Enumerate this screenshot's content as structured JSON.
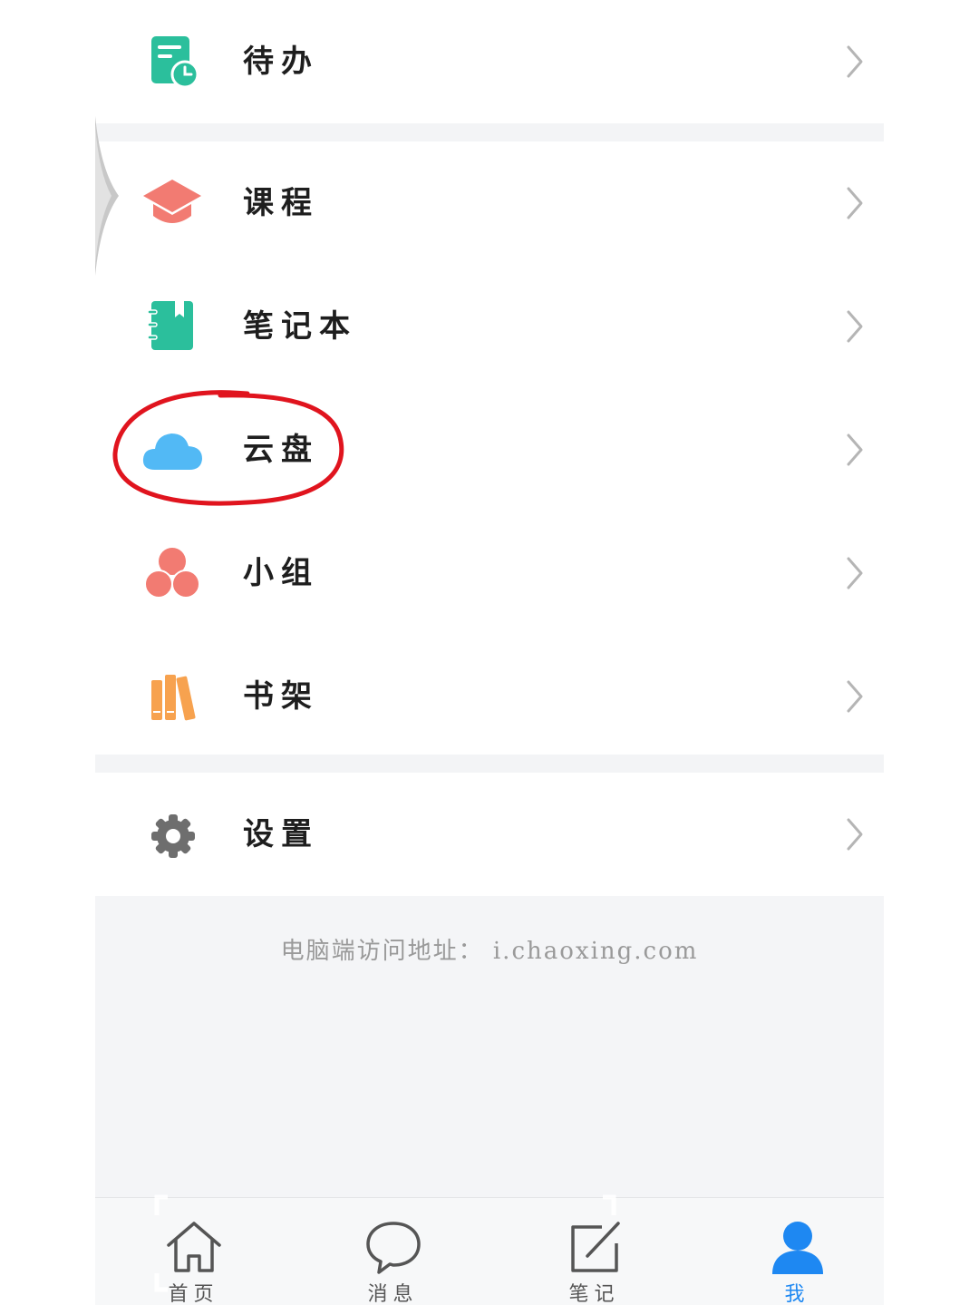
{
  "menu": {
    "items": [
      {
        "label": "待办",
        "icon": "todo-document-clock-icon",
        "color": "#2bbf9c"
      },
      {
        "label": "课程",
        "icon": "graduation-cap-icon",
        "color": "#f27b72"
      },
      {
        "label": "笔记本",
        "icon": "notebook-icon",
        "color": "#2bbf9c"
      },
      {
        "label": "云盘",
        "icon": "cloud-icon",
        "color": "#52b9f5"
      },
      {
        "label": "小组",
        "icon": "group-circles-icon",
        "color": "#f27b72"
      },
      {
        "label": "书架",
        "icon": "bookshelf-icon",
        "color": "#f7a24f"
      },
      {
        "label": "设置",
        "icon": "gear-icon",
        "color": "#6e6e6e"
      }
    ],
    "chevron_icon": "chevron-right-icon"
  },
  "footer": {
    "pc_address": "电脑端访问地址： i.chaoxing.com"
  },
  "tabbar": {
    "tabs": [
      {
        "label": "首页",
        "icon": "home-icon",
        "active": false
      },
      {
        "label": "消息",
        "icon": "message-bubble-icon",
        "active": false
      },
      {
        "label": "笔记",
        "icon": "note-edit-icon",
        "active": false
      },
      {
        "label": "我",
        "icon": "user-icon",
        "active": true
      }
    ],
    "active_color": "#1e88f2",
    "inactive_color": "#555555"
  },
  "annotation": {
    "color": "#e0141e"
  }
}
